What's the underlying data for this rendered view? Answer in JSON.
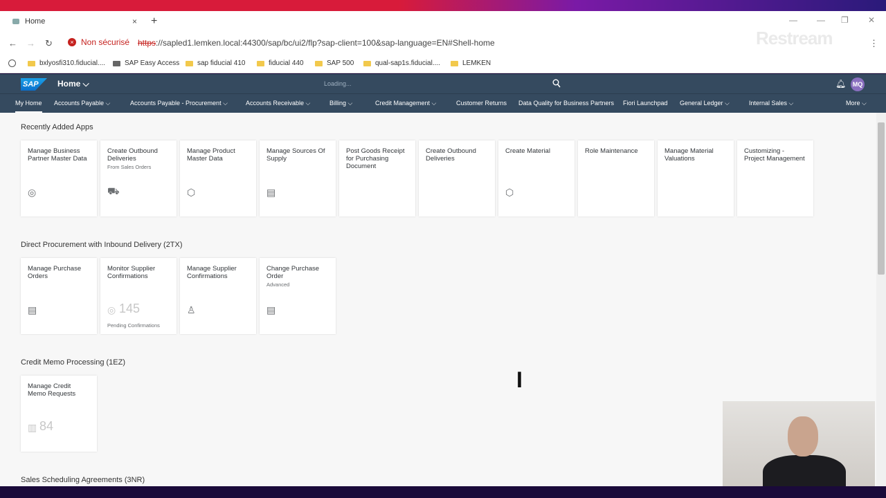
{
  "browser": {
    "tab_title": "Home",
    "tab_close": "×",
    "new_tab": "+",
    "insecure_label": "Non sécurisé",
    "url_scheme": "https",
    "url_rest": "://sapled1.lemken.local:44300/sap/bc/ui2/flp?sap-client=100&sap-language=EN#Shell-home",
    "watermark": "Restream",
    "bookmarks": [
      "bxlyosfi310.fiducial....",
      "SAP Easy Access",
      "sap fiducial 410",
      "fiducial 440",
      "SAP 500",
      "qual-sap1s.fiducial....",
      "LEMKEN"
    ]
  },
  "shell": {
    "logo": "SAP",
    "home_label": "Home ⌵",
    "loading": "Loading...",
    "avatar": "MQ"
  },
  "nav": [
    "My Home",
    "Accounts Payable ⌵",
    "Accounts Payable - Procurement ⌵",
    "Accounts Receivable ⌵",
    "Billing ⌵",
    "Credit Management ⌵",
    "Customer Returns",
    "Data Quality for Business Partners",
    "Fiori Launchpad",
    "General Ledger ⌵",
    "Internal Sales ⌵",
    "More ⌵"
  ],
  "sections": [
    {
      "title": "Recently Added Apps",
      "tiles": [
        {
          "title": "Manage Business Partner Master Data",
          "icon": "◎"
        },
        {
          "title": "Create Outbound Deliveries",
          "sub": "From Sales Orders",
          "icon": "⛟"
        },
        {
          "title": "Manage Product Master Data",
          "icon": "⬡"
        },
        {
          "title": "Manage Sources Of Supply",
          "icon": "▤"
        },
        {
          "title": "Post Goods Receipt for Purchasing Document"
        },
        {
          "title": "Create Outbound Deliveries"
        },
        {
          "title": "Create Material",
          "icon": "⬡"
        },
        {
          "title": "Role Maintenance"
        },
        {
          "title": "Manage Material Valuations"
        },
        {
          "title": "Customizing - Project Management"
        }
      ]
    },
    {
      "title": "Direct Procurement with Inbound Delivery (2TX)",
      "tiles": [
        {
          "title": "Manage Purchase Orders",
          "icon": "▤"
        },
        {
          "title": "Monitor Supplier Confirmations",
          "icon": "◎",
          "number": "145",
          "footer": "Pending Confirmations"
        },
        {
          "title": "Manage Supplier Confirmations",
          "icon": "♙"
        },
        {
          "title": "Change Purchase Order",
          "sub": "Advanced",
          "icon": "▤"
        }
      ]
    },
    {
      "title": "Credit Memo Processing (1EZ)",
      "tiles": [
        {
          "title": "Manage Credit Memo Requests",
          "icon": "▥",
          "number": "84"
        }
      ]
    },
    {
      "title": "Sales Scheduling Agreements (3NR)",
      "tiles": []
    }
  ]
}
